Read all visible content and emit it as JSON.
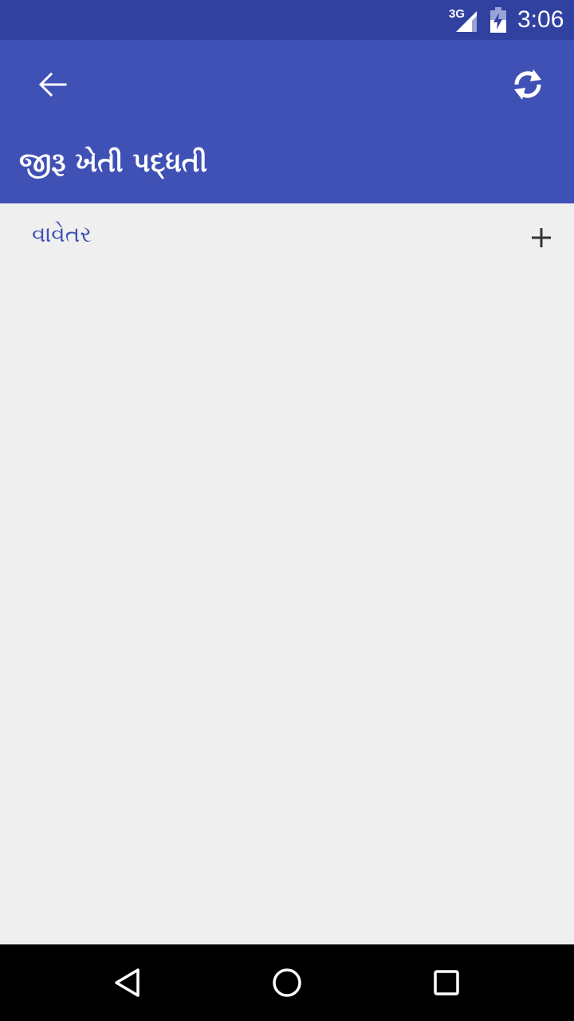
{
  "status_bar": {
    "network_label": "3G",
    "time": "3:06",
    "signal_icon": "signal-icon",
    "battery_icon": "battery-charging-icon"
  },
  "app_bar": {
    "title": "જીરૂ ખેતી પદ્ધતી",
    "back_icon": "arrow-back-icon",
    "refresh_icon": "refresh-icon"
  },
  "list": {
    "items": [
      {
        "label": "વાવેતર",
        "action_icon": "plus-icon"
      }
    ]
  },
  "nav_bar": {
    "back_icon": "nav-back-icon",
    "home_icon": "nav-home-icon",
    "recents_icon": "nav-recents-icon"
  },
  "colors": {
    "status_bar": "#3041a0",
    "app_bar": "#3f51b5",
    "background": "#efefef",
    "accent_text": "#3f51b5",
    "nav_bar": "#000000"
  }
}
